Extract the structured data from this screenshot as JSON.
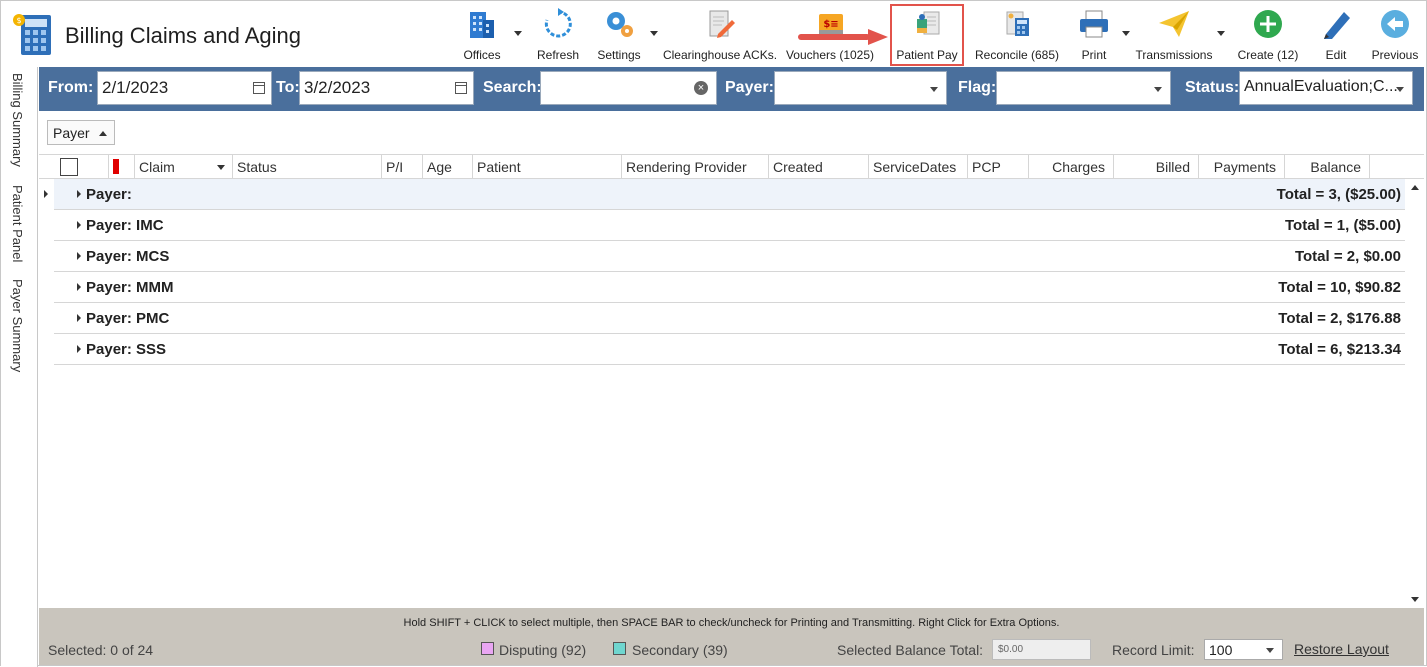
{
  "app": {
    "title": "Billing Claims and Aging"
  },
  "toolbar": {
    "offices": "Offices",
    "refresh": "Refresh",
    "settings": "Settings",
    "clearinghouse": "Clearinghouse ACKs.",
    "vouchers": "Vouchers (1025)",
    "patient_pay": "Patient Pay",
    "reconcile": "Reconcile (685)",
    "print": "Print",
    "transmissions": "Transmissions",
    "create": "Create (12)",
    "edit": "Edit",
    "previous": "Previous",
    "voucher_badge": "$☰"
  },
  "left_rail": {
    "tabs": [
      "Billing Summary",
      "Patient Panel",
      "Payer Summary"
    ]
  },
  "filters": {
    "from_label": "From:",
    "from_value": "2/1/2023",
    "to_label": "To:",
    "to_value": "3/2/2023",
    "search_label": "Search:",
    "search_value": "",
    "payer_label": "Payer:",
    "payer_value": "",
    "flag_label": "Flag:",
    "flag_value": "",
    "status_label": "Status:",
    "status_value": "AnnualEvaluation;C..."
  },
  "group_by": {
    "label": "Payer"
  },
  "grid": {
    "columns": [
      "Claim",
      "Status",
      "P/I",
      "Age",
      "Patient",
      "Rendering Provider",
      "Created",
      "ServiceDates",
      "PCP",
      "Charges",
      "Billed",
      "Payments",
      "Balance"
    ],
    "groups": [
      {
        "name": "Payer:",
        "total": "Total = 3,  ($25.00)"
      },
      {
        "name": "Payer: IMC",
        "total": "Total = 1,  ($5.00)"
      },
      {
        "name": "Payer: MCS",
        "total": "Total = 2,  $0.00"
      },
      {
        "name": "Payer: MMM",
        "total": "Total = 10,  $90.82"
      },
      {
        "name": "Payer: PMC",
        "total": "Total = 2,  $176.88"
      },
      {
        "name": "Payer: SSS",
        "total": "Total = 6,  $213.34"
      }
    ]
  },
  "footer": {
    "hint": "Hold SHIFT + CLICK to select multiple, then SPACE BAR to check/uncheck for Printing and Transmitting. Right Click for Extra Options.",
    "selected": "Selected: 0 of 24",
    "disputing": "Disputing (92)",
    "disputing_color": "#e9a6f2",
    "secondary": "Secondary (39)",
    "secondary_color": "#6fd6cf",
    "selected_balance_label": "Selected Balance Total:",
    "selected_balance_value": "$0.00",
    "record_limit_label": "Record Limit:",
    "record_limit_value": "100",
    "restore_layout": "Restore Layout"
  }
}
